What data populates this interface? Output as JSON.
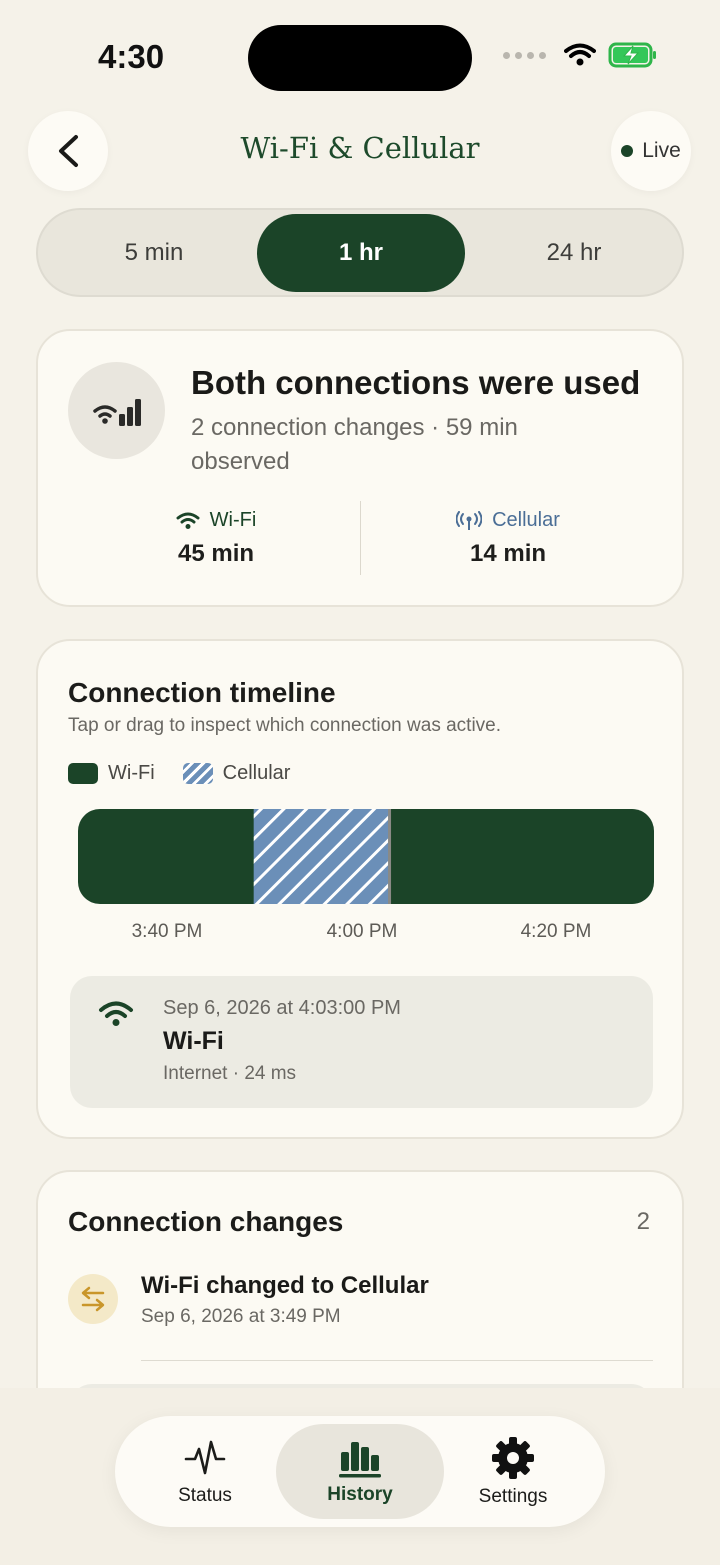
{
  "status_bar": {
    "time": "4:30"
  },
  "header": {
    "title": "Wi-Fi & Cellular",
    "live_label": "Live"
  },
  "range": {
    "options": [
      "5 min",
      "1 hr",
      "24 hr"
    ],
    "selected": "1 hr"
  },
  "summary": {
    "title": "Both connections were used",
    "subtitle": "2 connection changes · 59 min observed",
    "wifi": {
      "label": "Wi-Fi",
      "value": "45 min"
    },
    "cellular": {
      "label": "Cellular",
      "value": "14 min"
    }
  },
  "timeline": {
    "title": "Connection timeline",
    "subtitle": "Tap or drag to inspect which connection was active.",
    "legend": {
      "wifi": "Wi-Fi",
      "cellular": "Cellular"
    },
    "ticks": [
      "3:40 PM",
      "4:00 PM",
      "4:20 PM"
    ],
    "segments": [
      {
        "type": "wifi",
        "fraction": 0.305
      },
      {
        "type": "cellular",
        "fraction": 0.235
      },
      {
        "type": "wifi",
        "fraction": 0.46
      }
    ],
    "selected": {
      "time": "Sep 6, 2026 at 4:03:00 PM",
      "connection": "Wi-Fi",
      "detail": "Internet · 24 ms"
    }
  },
  "changes": {
    "title": "Connection changes",
    "count": "2",
    "items": [
      {
        "title": "Wi-Fi changed to Cellular",
        "time": "Sep 6, 2026 at 3:49 PM"
      }
    ]
  },
  "tabbar": {
    "status": "Status",
    "history": "History",
    "settings": "Settings",
    "active": "History"
  },
  "colors": {
    "accent": "#1b4428",
    "cellular": "#6b8fb8",
    "background": "#f5f2e9"
  }
}
